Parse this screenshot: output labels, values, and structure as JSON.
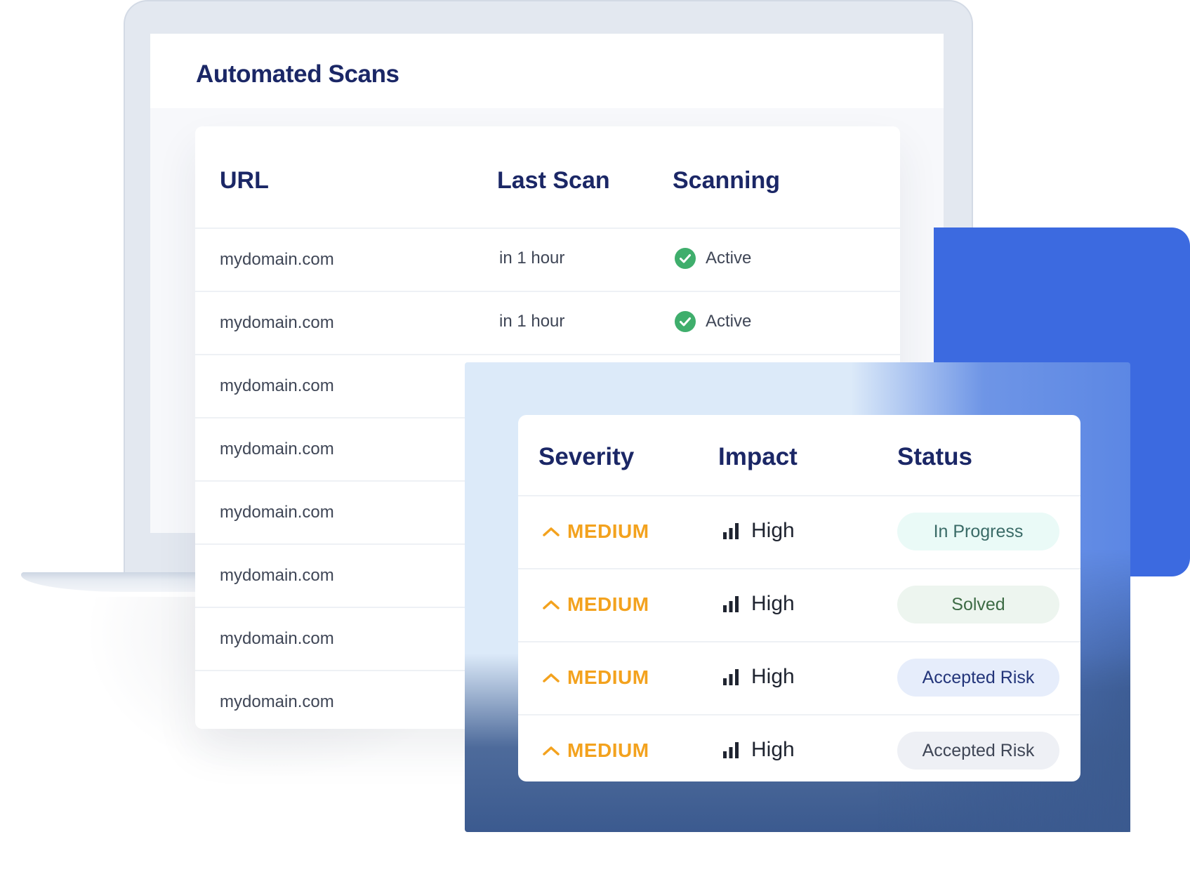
{
  "scans_panel": {
    "title": "Automated Scans",
    "columns": {
      "url": "URL",
      "last_scan": "Last Scan",
      "scanning": "Scanning"
    },
    "rows": [
      {
        "url": "mydomain.com",
        "last_scan": "in 1 hour",
        "scanning": "Active"
      },
      {
        "url": "mydomain.com",
        "last_scan": "in 1 hour",
        "scanning": "Active"
      },
      {
        "url": "mydomain.com"
      },
      {
        "url": "mydomain.com"
      },
      {
        "url": "mydomain.com"
      },
      {
        "url": "mydomain.com"
      },
      {
        "url": "mydomain.com"
      },
      {
        "url": "mydomain.com"
      }
    ]
  },
  "findings_panel": {
    "columns": {
      "severity": "Severity",
      "impact": "Impact",
      "status": "Status"
    },
    "rows": [
      {
        "severity": "MEDIUM",
        "impact": "High",
        "status": "In Progress"
      },
      {
        "severity": "MEDIUM",
        "impact": "High",
        "status": "Solved"
      },
      {
        "severity": "MEDIUM",
        "impact": "High",
        "status": "Accepted Risk"
      },
      {
        "severity": "MEDIUM",
        "impact": "High",
        "status": "Accepted Risk"
      }
    ]
  },
  "colors": {
    "title": "#1b2766",
    "active_check": "#3fae6c",
    "severity_medium": "#f3a21e",
    "accent_blue": "#3c6ae0"
  },
  "icons": {
    "scanning_status": "check-circle-icon",
    "severity": "chevron-up-icon",
    "impact": "signal-bars-icon"
  }
}
